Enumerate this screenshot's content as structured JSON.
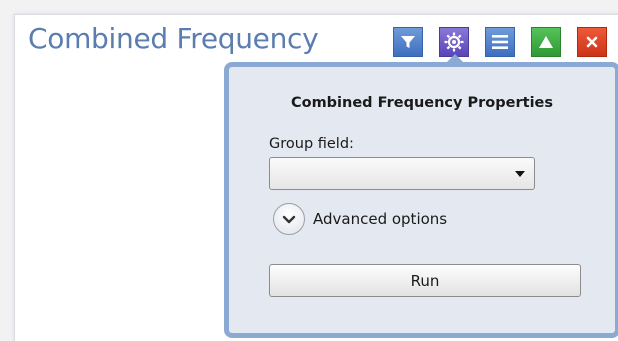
{
  "panel": {
    "title": "Combined Frequency",
    "toolbar": [
      {
        "icon": "filter-icon",
        "color": "#3e6fc0"
      },
      {
        "icon": "gear-icon",
        "color": "#5a44b8"
      },
      {
        "icon": "list-icon",
        "color": "#3e6fc0"
      },
      {
        "icon": "triangle-up-icon",
        "color": "#2f9a34"
      },
      {
        "icon": "close-icon",
        "color": "#cc3418"
      }
    ]
  },
  "properties": {
    "heading": "Combined Frequency Properties",
    "group_field_label": "Group field:",
    "group_field_value": "",
    "advanced_label": "Advanced options",
    "run_label": "Run"
  },
  "colors": {
    "title": "#5b7db0",
    "popup_border": "#8aaad3",
    "popup_background": "#e4e9f1"
  }
}
